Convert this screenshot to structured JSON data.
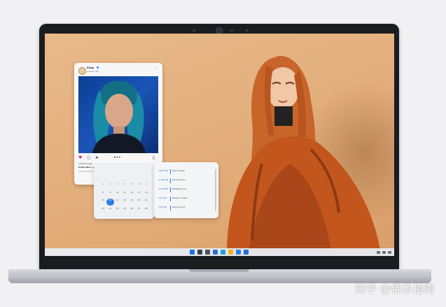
{
  "post": {
    "account_name": "Snap",
    "account_sub": "Seattle, WA",
    "more_icon": "⋮",
    "likes": "10,220 views",
    "caption_user": "Inspiration_spot",
    "caption_text": " the latest and greatest from your",
    "comments": "View all 998 comments",
    "icons": [
      "heart-icon",
      "comment-icon",
      "share-icon",
      "more-dots-icon",
      "bookmark-icon"
    ]
  },
  "calendar": {
    "days": [
      "1",
      "2",
      "3",
      "4",
      "5",
      "6",
      "7",
      "8",
      "9",
      "10",
      "11",
      "12",
      "13",
      "14",
      "15",
      "16",
      "17",
      "18",
      "19",
      "20",
      "21",
      "22",
      "23",
      "24",
      "25",
      "26",
      "27",
      "28"
    ],
    "today_index": 15
  },
  "events": {
    "items": [
      {
        "time": "10:00 AM",
        "title": "Lab meetup"
      },
      {
        "time": "11:00 AM",
        "title": "Art priorities"
      },
      {
        "time": "12:00 PM",
        "title": "Strategy sync"
      },
      {
        "time": "3:00 PM",
        "title": "Design review"
      },
      {
        "time": "5:00 PM",
        "title": "Studio block"
      }
    ]
  },
  "taskbar": {
    "icons": [
      "windows-start-icon",
      "search-icon",
      "task-view-icon",
      "widgets-icon",
      "edge-browser-icon",
      "file-explorer-icon",
      "store-icon",
      "mail-icon"
    ],
    "colors": [
      "#1a73e8",
      "#3a3f47",
      "#4a4f58",
      "#2c6fd1",
      "#1ea0d8",
      "#f2b01e",
      "#2d7ee0",
      "#1e6fcf"
    ]
  },
  "watermark": "知乎 @佛系指南",
  "colors": {
    "wallpaper": "#e2ad7a",
    "accent": "#2d7ee0",
    "coat": "#c2561c",
    "hair": "#c8652a"
  }
}
